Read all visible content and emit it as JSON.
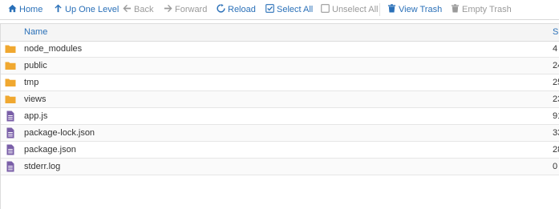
{
  "toolbar": {
    "home": "Home",
    "up": "Up One Level",
    "back": "Back",
    "forward": "Forward",
    "reload": "Reload",
    "select_all": "Select All",
    "unselect_all": "Unselect All",
    "view_trash": "View Trash",
    "empty_trash": "Empty Trash"
  },
  "colors": {
    "accent": "#2a70b8",
    "folder": "#f0a830",
    "file": "#7a5fa8"
  },
  "table": {
    "columns": [
      "Name",
      "Si"
    ],
    "rows": [
      {
        "name": "node_modules",
        "size": "4",
        "icon": "folder-icon"
      },
      {
        "name": "public",
        "size": "24",
        "icon": "folder-icon"
      },
      {
        "name": "tmp",
        "size": "25",
        "icon": "folder-icon"
      },
      {
        "name": "views",
        "size": "23",
        "icon": "folder-icon"
      },
      {
        "name": "app.js",
        "size": "91",
        "icon": "file-icon"
      },
      {
        "name": "package-lock.json",
        "size": "33",
        "icon": "file-icon"
      },
      {
        "name": "package.json",
        "size": "28",
        "icon": "file-icon"
      },
      {
        "name": "stderr.log",
        "size": "0",
        "icon": "file-icon"
      }
    ]
  }
}
